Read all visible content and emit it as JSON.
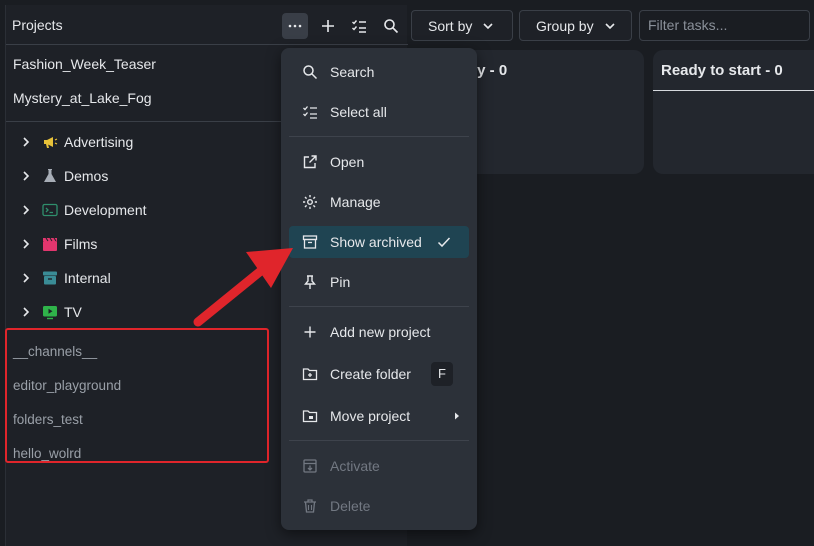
{
  "projects_panel": {
    "title": "Projects",
    "header_buttons": [
      "more-icon",
      "plus-icon",
      "checklist-icon",
      "search-icon"
    ],
    "pinned": [
      "Fashion_Week_Teaser",
      "Mystery_at_Lake_Fog"
    ],
    "folders": [
      {
        "label": "Advertising",
        "icon": "megaphone-icon",
        "color": "#e8c23a"
      },
      {
        "label": "Demos",
        "icon": "flask-icon",
        "color": "#a7adb6"
      },
      {
        "label": "Development",
        "icon": "terminal-icon",
        "color": "#2f8f6c"
      },
      {
        "label": "Films",
        "icon": "clapperboard-icon",
        "color": "#e2366e"
      },
      {
        "label": "Internal",
        "icon": "archive-box-icon",
        "color": "#3a8c96"
      },
      {
        "label": "TV",
        "icon": "tv-play-icon",
        "color": "#2fb44a"
      }
    ],
    "archived": [
      "__channels__",
      "editor_playground",
      "folders_test",
      "hello_wolrd"
    ]
  },
  "toolbar": {
    "sort_label": "Sort by",
    "group_label": "Group by",
    "filter_placeholder": "Filter tasks..."
  },
  "board": {
    "columns": [
      "dy - 0",
      "Ready to start - 0"
    ]
  },
  "menu": {
    "search": "Search",
    "select_all": "Select all",
    "open": "Open",
    "manage": "Manage",
    "show_archived": "Show archived",
    "pin": "Pin",
    "add_new_project": "Add new project",
    "create_folder": "Create folder",
    "create_folder_shortcut": "F",
    "move_project": "Move project",
    "activate": "Activate",
    "delete": "Delete"
  },
  "colors": {
    "highlight": "#e0252b",
    "selected_item": "#1f4452"
  }
}
